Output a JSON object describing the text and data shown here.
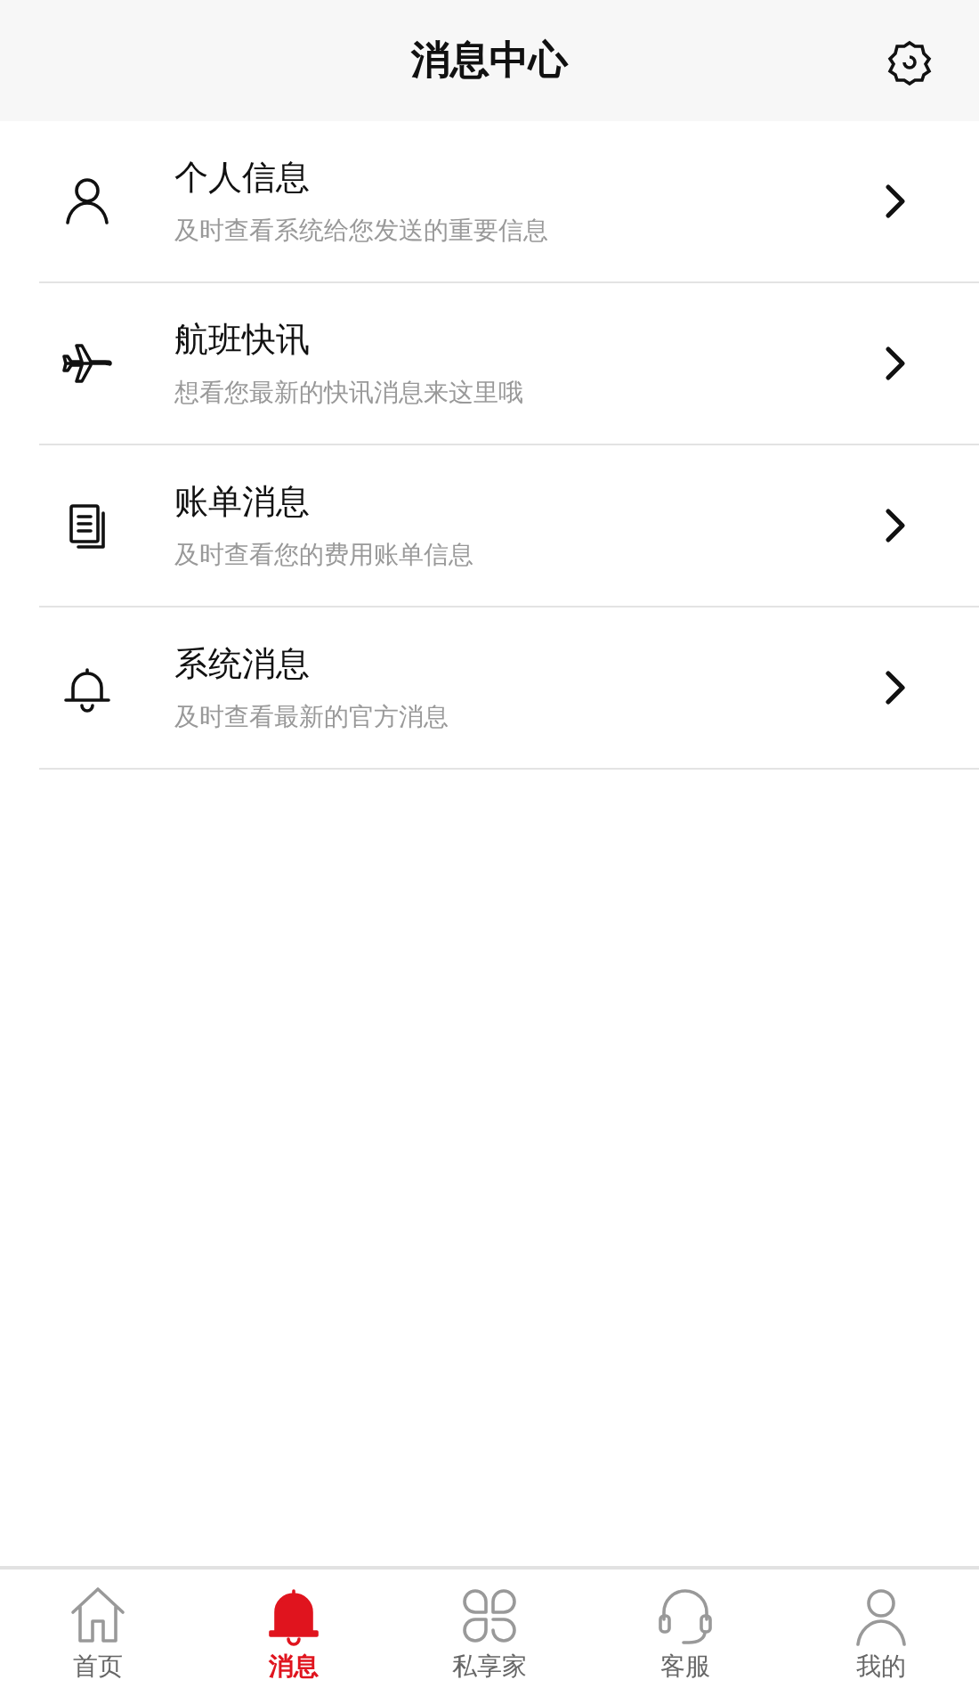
{
  "header": {
    "title": "消息中心"
  },
  "items": [
    {
      "kind": "person",
      "title": "个人信息",
      "subtitle": "及时查看系统给您发送的重要信息"
    },
    {
      "kind": "plane",
      "title": "航班快讯",
      "subtitle": "想看您最新的快讯消息来这里哦"
    },
    {
      "kind": "bill",
      "title": "账单消息",
      "subtitle": "及时查看您的费用账单信息"
    },
    {
      "kind": "bell",
      "title": "系统消息",
      "subtitle": "及时查看最新的官方消息"
    }
  ],
  "tabs": [
    {
      "kind": "home",
      "label": "首页",
      "selected": false
    },
    {
      "kind": "bell",
      "label": "消息",
      "selected": true
    },
    {
      "kind": "clover",
      "label": "私享家",
      "selected": false
    },
    {
      "kind": "headset",
      "label": "客服",
      "selected": false
    },
    {
      "kind": "person",
      "label": "我的",
      "selected": false
    }
  ]
}
